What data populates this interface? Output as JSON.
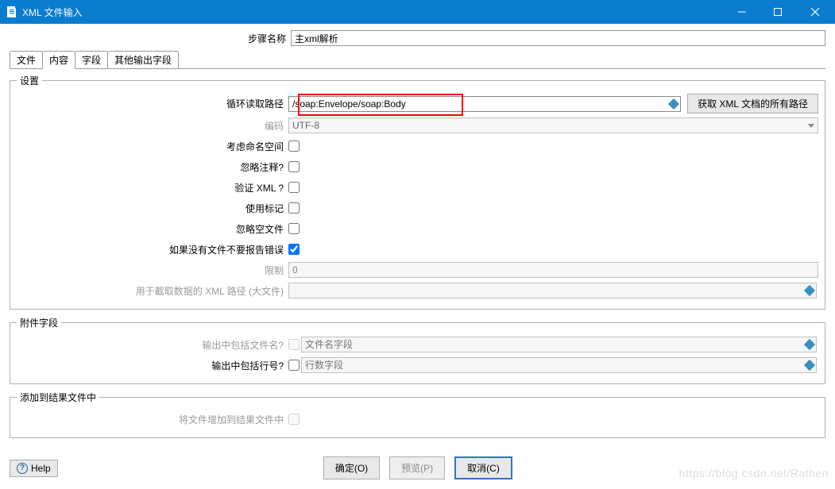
{
  "window": {
    "title": "XML 文件输入"
  },
  "step": {
    "label": "步骤名称",
    "value": "主xml解析"
  },
  "tabs": {
    "file": "文件",
    "content": "内容",
    "fields": "字段",
    "other": "其他输出字段"
  },
  "settings": {
    "legend": "设置",
    "loop_path_label": "循环读取路径",
    "loop_path_value": "/soap:Envelope/soap:Body",
    "get_paths_btn": "获取 XML 文档的所有路径",
    "encoding_label": "编码",
    "encoding_value": "UTF-8",
    "namespace_label": "考虑命名空间",
    "ignore_comment_label": "忽略注释?",
    "validate_label": "验证 XML ?",
    "use_tag_label": "使用标记",
    "ignore_empty_label": "忽略空文件",
    "no_error_label": "如果没有文件不要报告错误",
    "limit_label": "限制",
    "limit_value": "0",
    "big_xml_label": "用于截取数据的 XML 路径 (大文件)",
    "big_xml_value": ""
  },
  "attachment": {
    "legend": "附件字段",
    "include_filename_label": "输出中包括文件名?",
    "filename_placeholder": "文件名字段",
    "include_rownum_label": "输出中包括行号?",
    "rownum_placeholder": "行数字段"
  },
  "addresult": {
    "legend": "添加到结果文件中",
    "add_to_result_label": "将文件增加到结果文件中"
  },
  "buttons": {
    "help": "Help",
    "ok": "确定(O)",
    "preview": "预览(P)",
    "cancel": "取消(C)"
  },
  "watermark": "https://blog.csdn.net/Rathen"
}
